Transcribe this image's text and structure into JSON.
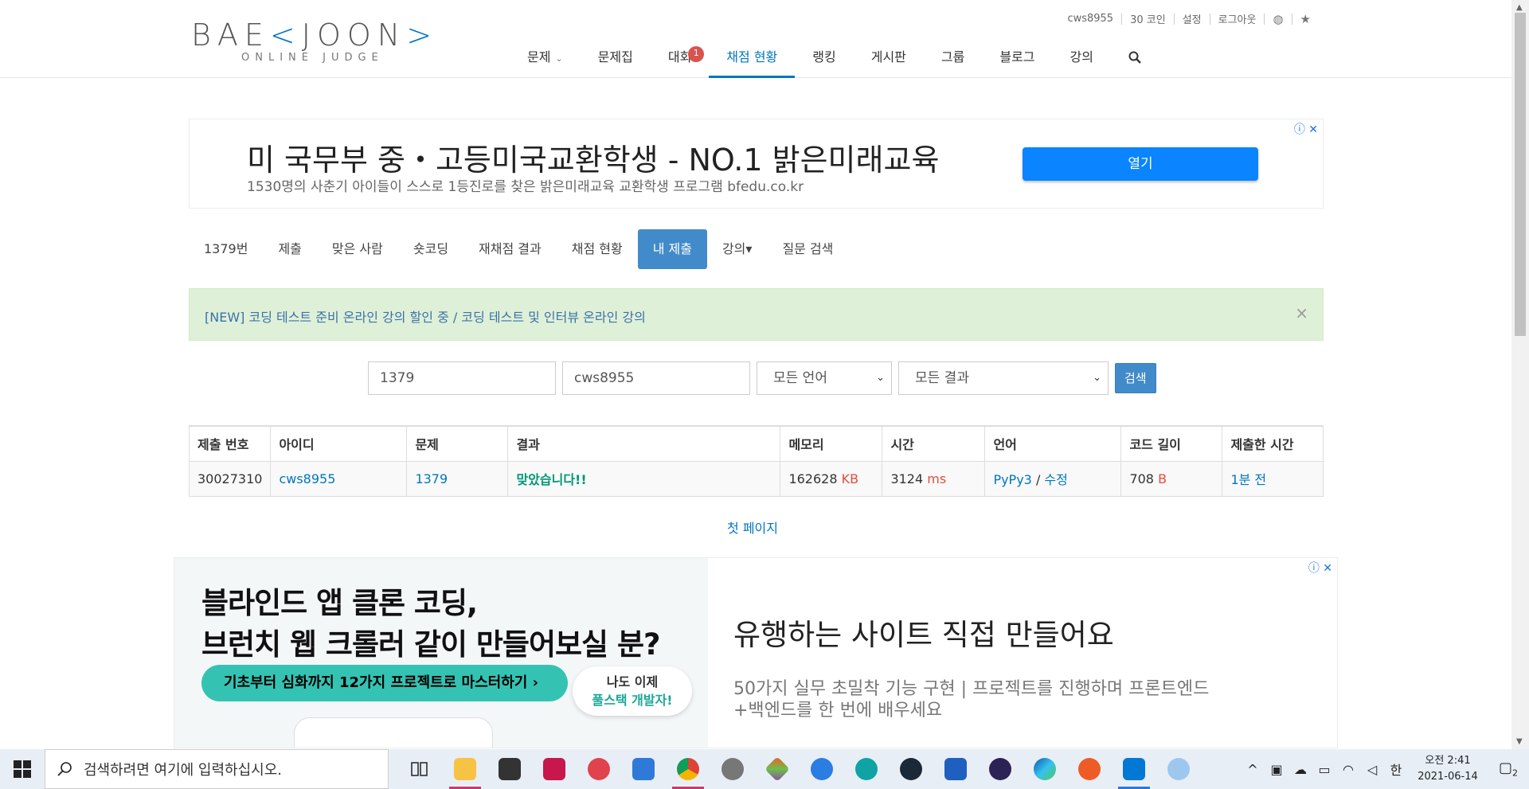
{
  "header": {
    "logo_left": "BAE",
    "logo_mid": "<",
    "logo_right": "JOON",
    "logo_end": ">",
    "logo_sub": "ONLINE JUDGE",
    "topbar": [
      "cws8955",
      "30 코인",
      "설정",
      "로그아웃"
    ],
    "nav": [
      {
        "label": "문제",
        "caret": "⌄"
      },
      {
        "label": "문제집"
      },
      {
        "label": "대회",
        "badge": "1"
      },
      {
        "label": "채점 현황",
        "active": true
      },
      {
        "label": "랭킹"
      },
      {
        "label": "게시판"
      },
      {
        "label": "그룹"
      },
      {
        "label": "블로그"
      },
      {
        "label": "강의"
      }
    ]
  },
  "ad1": {
    "title": "미 국무부 중・고등미국교환학생 - NO.1 밝은미래교육",
    "subtitle": "1530명의 사춘기 아이들이 스스로 1등진로를 찾은 밝은미래교육 교환학생 프로그램 bfedu.co.kr",
    "button": "열기",
    "info": "ⓘ",
    "close": "✕"
  },
  "problem_menu": [
    "1379번",
    "제출",
    "맞은 사람",
    "숏코딩",
    "재채점 결과",
    "채점 현황",
    "내 제출",
    "강의▾",
    "질문 검색"
  ],
  "notice": {
    "text": "[NEW] 코딩 테스트 준비 온라인 강의 할인 중 / 코딩 테스트 및 인터뷰 온라인 강의",
    "close": "×"
  },
  "search": {
    "problem_id": "1379",
    "user_id": "cws8955",
    "language": "모든 언어",
    "result": "모든 결과",
    "button": "검색"
  },
  "table": {
    "headers": [
      "제출 번호",
      "아이디",
      "문제",
      "결과",
      "메모리",
      "시간",
      "언어",
      "코드 길이",
      "제출한 시간"
    ],
    "row": {
      "submission_id": "30027310",
      "user": "cws8955",
      "problem": "1379",
      "result": "맞았습니다!!",
      "memory": "162628",
      "memory_unit": "KB",
      "time": "3124",
      "time_unit": "ms",
      "language": "PyPy3",
      "lang_sep": " / ",
      "edit": "수정",
      "code_length": "708",
      "code_unit": "B",
      "submitted": "1분 전"
    }
  },
  "first_page": "첫 페이지",
  "ad2": {
    "headline1": "블라인드 앱 클론 코딩,",
    "headline2": "브런치 웹 크롤러 같이 만들어보실 분?",
    "pill": "기초부터 심화까지 12가지 프로젝트로 마스터하기  ›",
    "bubble1": "나도 이제",
    "bubble2": "풀스택 개발자!",
    "title": "유행하는 사이트 직접 만들어요",
    "sub1": "50가지 실무 초밀착 기능 구현 | 프로젝트를 진행하며 프론트엔드",
    "sub2": "+백엔드를 한 번에 배우세요",
    "info": "ⓘ",
    "close": "✕"
  },
  "taskbar": {
    "search_placeholder": "검색하려면 여기에 입력하십시오.",
    "ime": "한",
    "clock_time": "오전 2:41",
    "clock_date": "2021-06-14",
    "notif_count": "2"
  }
}
